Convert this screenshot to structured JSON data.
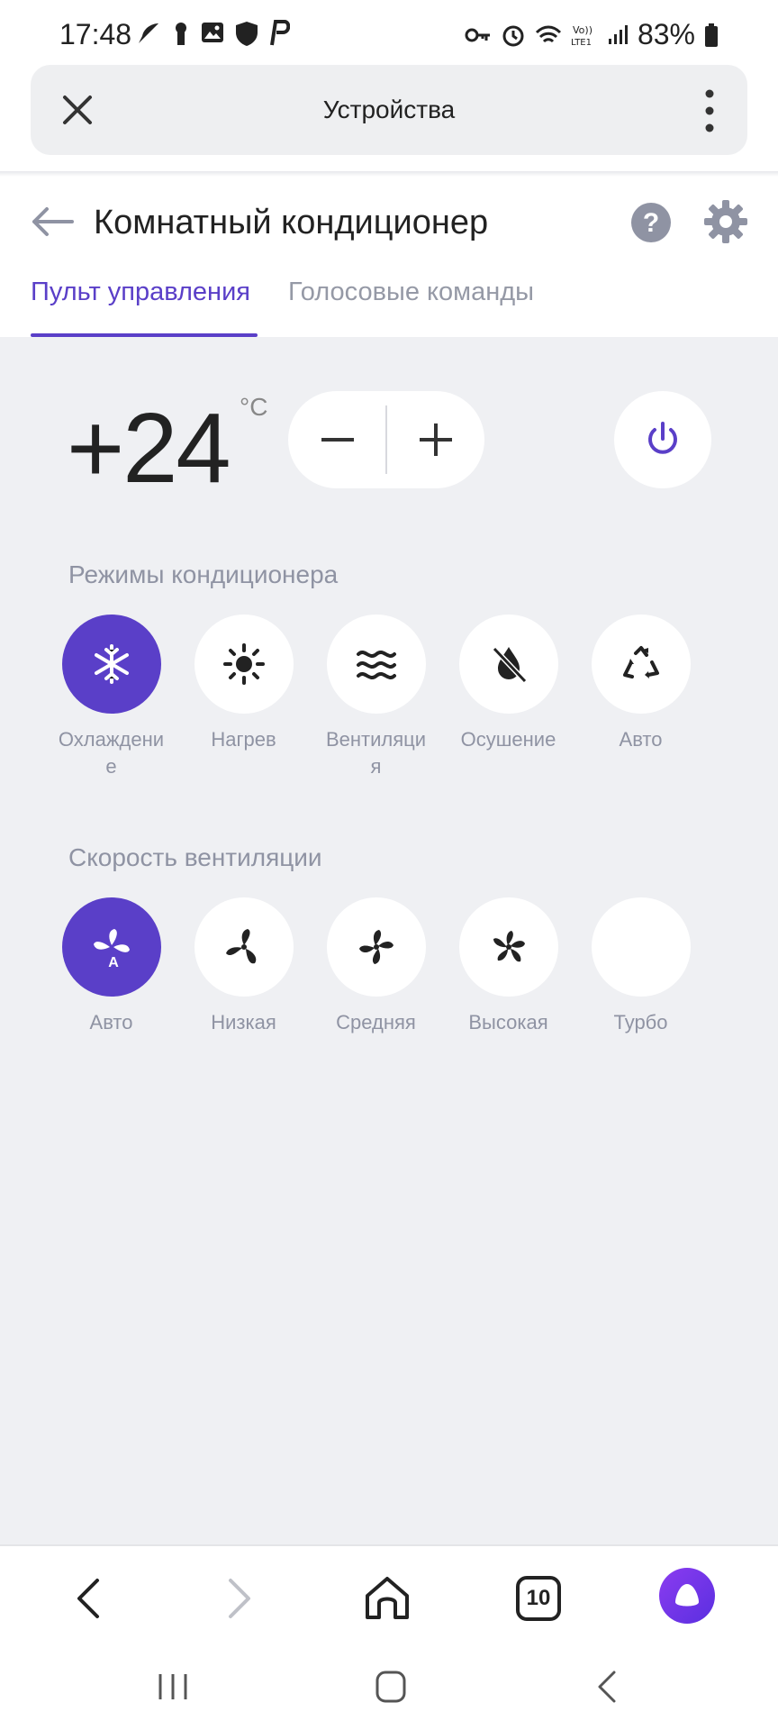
{
  "status_bar": {
    "time": "17:48",
    "battery_percent": "83%",
    "left_icons": [
      "feather-icon",
      "keyhole-icon",
      "image-icon",
      "shield-phone-icon",
      "p-app-icon"
    ],
    "right_icons": [
      "vpn-key-icon",
      "alarm-icon",
      "wifi-icon",
      "volte-icon",
      "signal-icon",
      "battery-icon"
    ]
  },
  "browser": {
    "title": "Устройства"
  },
  "header": {
    "title": "Комнатный кондиционер",
    "tabs": [
      {
        "label": "Пульт управления",
        "active": true
      },
      {
        "label": "Голосовые команды",
        "active": false
      }
    ]
  },
  "temperature": {
    "value": "+24",
    "unit": "°C"
  },
  "modes": {
    "title": "Режимы кондиционера",
    "items": [
      {
        "label": "Охлаждение",
        "icon": "snowflake-icon",
        "active": true
      },
      {
        "label": "Нагрев",
        "icon": "sun-icon",
        "active": false
      },
      {
        "label": "Вентиляция",
        "icon": "waves-icon",
        "active": false
      },
      {
        "label": "Осушение",
        "icon": "no-drop-icon",
        "active": false
      },
      {
        "label": "Авто",
        "icon": "recycle-icon",
        "active": false
      }
    ]
  },
  "speed": {
    "title": "Скорость вентиляции",
    "items": [
      {
        "label": "Авто",
        "icon": "fan-auto-icon",
        "active": true
      },
      {
        "label": "Низкая",
        "icon": "fan-low-icon",
        "active": false
      },
      {
        "label": "Средняя",
        "icon": "fan-medium-icon",
        "active": false
      },
      {
        "label": "Высокая",
        "icon": "fan-high-icon",
        "active": false
      },
      {
        "label": "Турбо",
        "icon": "",
        "active": false
      }
    ]
  },
  "bottom_nav": {
    "tabs_count": "10"
  },
  "colors": {
    "accent": "#5a3fc8",
    "background": "#eff0f3",
    "muted_text": "#8f93a3"
  }
}
